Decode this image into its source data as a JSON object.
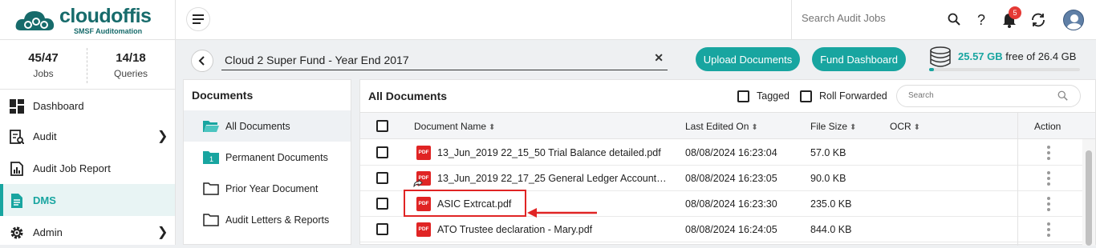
{
  "brand": {
    "name": "cloudoffis",
    "tagline": "SMSF Auditomation"
  },
  "top_search": {
    "placeholder": "Search Audit Jobs"
  },
  "notifications": {
    "count": "5"
  },
  "stats": [
    {
      "value": "45/47",
      "label": "Jobs"
    },
    {
      "value": "14/18",
      "label": "Queries"
    }
  ],
  "nav": [
    {
      "label": "Dashboard",
      "icon": "dashboard-icon",
      "chevron": false
    },
    {
      "label": "Audit",
      "icon": "audit-icon",
      "chevron": true
    },
    {
      "label": "Audit Job Report",
      "icon": "report-icon",
      "chevron": false
    },
    {
      "label": "DMS",
      "icon": "document-icon",
      "chevron": false,
      "active": true
    },
    {
      "label": "Admin",
      "icon": "gear-icon",
      "chevron": true
    }
  ],
  "job": {
    "title": "Cloud 2 Super Fund - Year End 2017",
    "clear": "✕"
  },
  "buttons": {
    "upload": "Upload Documents",
    "fund_dashboard": "Fund Dashboard"
  },
  "storage": {
    "used": "25.57 GB",
    "suffix": "free of 26.4 GB",
    "fraction": 0.031
  },
  "folders": {
    "title": "Documents",
    "items": [
      {
        "label": "All Documents",
        "icon": "folder-open-icon",
        "active": true
      },
      {
        "label": "Permanent Documents",
        "icon": "folder-numbered-icon"
      },
      {
        "label": "Prior Year Document",
        "icon": "folder-icon"
      },
      {
        "label": "Audit Letters & Reports",
        "icon": "folder-icon"
      }
    ]
  },
  "table": {
    "title": "All Documents",
    "filters": {
      "tagged": "Tagged",
      "roll_forwarded": "Roll Forwarded"
    },
    "search_placeholder": "Search",
    "columns": {
      "name": "Document Name",
      "edited": "Last Edited On",
      "size": "File Size",
      "ocr": "OCR",
      "action": "Action"
    },
    "rows": [
      {
        "name": "13_Jun_2019 22_15_50 Trial Balance detailed.pdf",
        "edited": "08/08/2024 16:23:04",
        "size": "57.0 KB",
        "icon": "pdf-icon"
      },
      {
        "name": "13_Jun_2019 22_17_25 General Ledger Account…",
        "edited": "08/08/2024 16:23:05",
        "size": "90.0 KB",
        "icon": "pdf-rollforward-icon"
      },
      {
        "name": "ASIC Extrcat.pdf",
        "edited": "08/08/2024 16:23:30",
        "size": "235.0 KB",
        "icon": "pdf-icon",
        "highlighted": true
      },
      {
        "name": "ATO Trustee declaration - Mary.pdf",
        "edited": "08/08/2024 16:24:05",
        "size": "844.0 KB",
        "icon": "pdf-icon"
      }
    ]
  },
  "pdf_badge": "PDF",
  "colors": {
    "accent": "#18a5a0",
    "highlight": "#e02424"
  }
}
